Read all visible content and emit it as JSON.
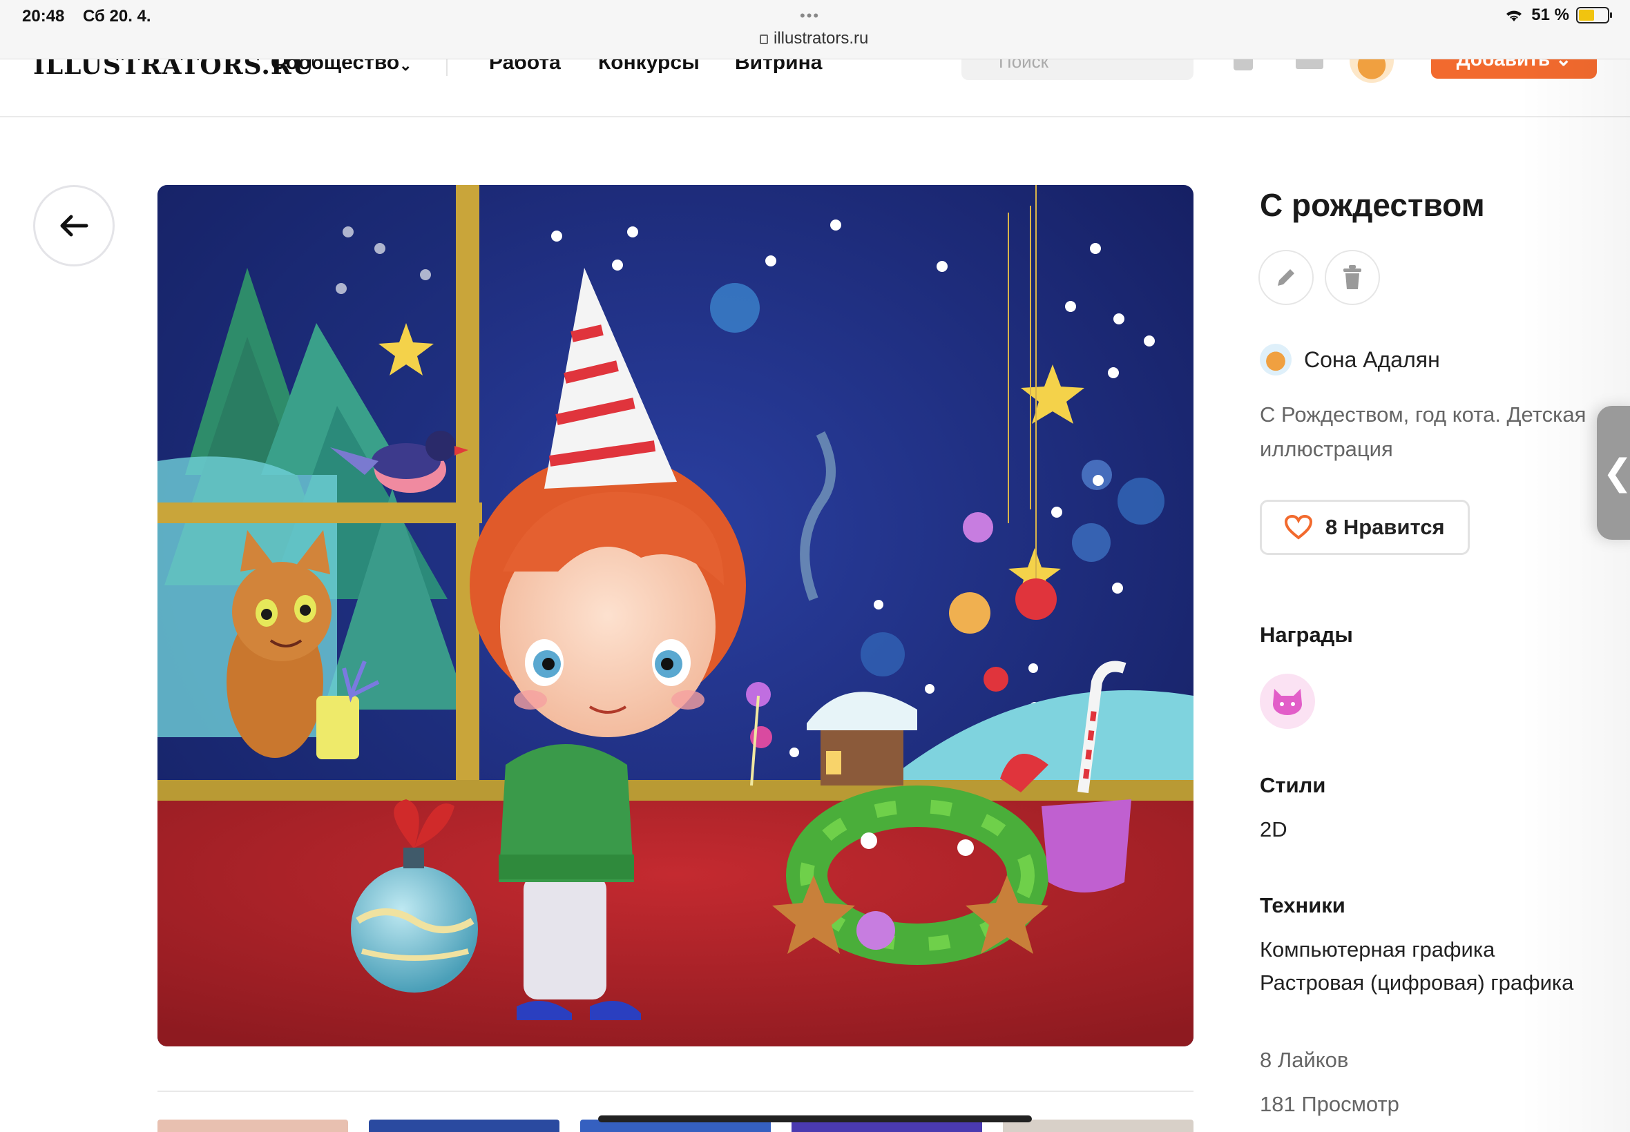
{
  "status_bar": {
    "time": "20:48",
    "date": "Сб 20. 4.",
    "url": "illustrators.ru",
    "battery": "51 %"
  },
  "header": {
    "logo": "ILLUSTRATORS.RU",
    "nav": [
      "Сообщество",
      "Работа",
      "Конкурсы",
      "Витрина"
    ],
    "search_placeholder": "Поиск",
    "add_label": "Добавить"
  },
  "artwork": {
    "title": "С рождеством",
    "author": "Сона Адалян",
    "description_line1": "С Рождеством, год кота. Детская",
    "description_line2": "иллюстрация",
    "like_label": "8 Нравится",
    "awards_label": "Награды",
    "styles_label": "Стили",
    "style_value": "2D",
    "techniques_label": "Техники",
    "techniques": [
      "Компьютерная графика",
      "Растровая (цифровая) графика"
    ],
    "likes_count": "8 Лайков",
    "views_count": "181 Просмотр"
  },
  "colors": {
    "accent": "#f26a2e",
    "heart": "#f26a2e",
    "night_sky": "#1c2a7a",
    "floor": "#b8232a"
  }
}
